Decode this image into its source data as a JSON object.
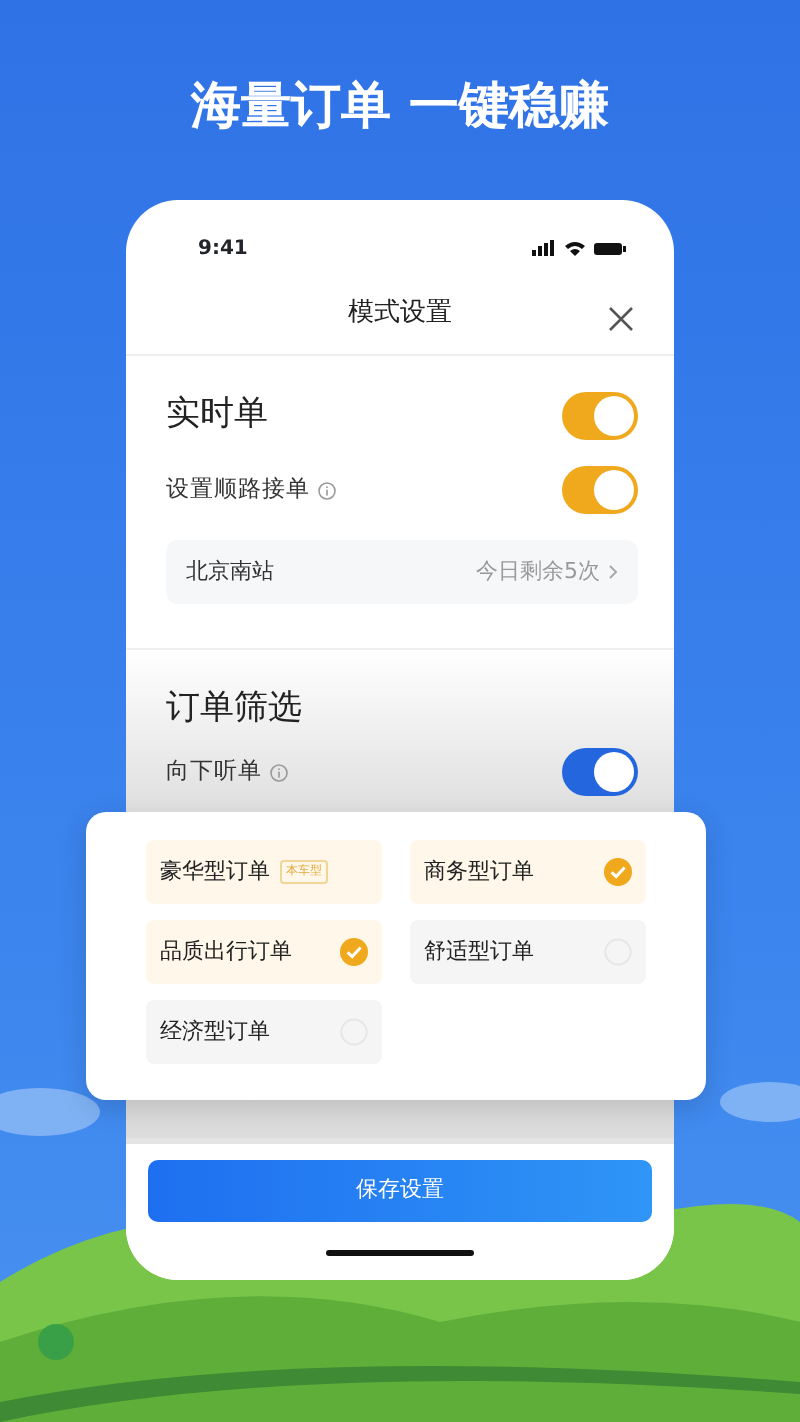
{
  "headline": "海量订单 一键稳赚",
  "phone": {
    "status_time": "9:41",
    "title": "模式设置",
    "sections": [
      {
        "title": "实时单",
        "toggle": {
          "on": true,
          "color": "#f0a81c"
        },
        "rows": [
          {
            "label": "设置顺路接单",
            "toggle": {
              "on": true,
              "color": "#f0a81c"
            }
          }
        ],
        "station": {
          "name": "北京南站",
          "remaining": "今日剩余5次"
        }
      },
      {
        "title": "订单筛选",
        "rows": [
          {
            "label": "向下听单",
            "toggle": {
              "on": true,
              "color": "#2466de"
            }
          }
        ]
      }
    ],
    "save_button": "保存设置"
  },
  "popup": {
    "options": [
      {
        "kind": "tagged",
        "label": "豪华型订单",
        "tag": "本车型"
      },
      {
        "kind": "option",
        "label": "商务型订单",
        "selected": true
      },
      {
        "kind": "option",
        "label": "品质出行订单",
        "selected": true
      },
      {
        "kind": "option",
        "label": "舒适型订单",
        "selected": false
      },
      {
        "kind": "option",
        "label": "经济型订单",
        "selected": false
      }
    ]
  }
}
